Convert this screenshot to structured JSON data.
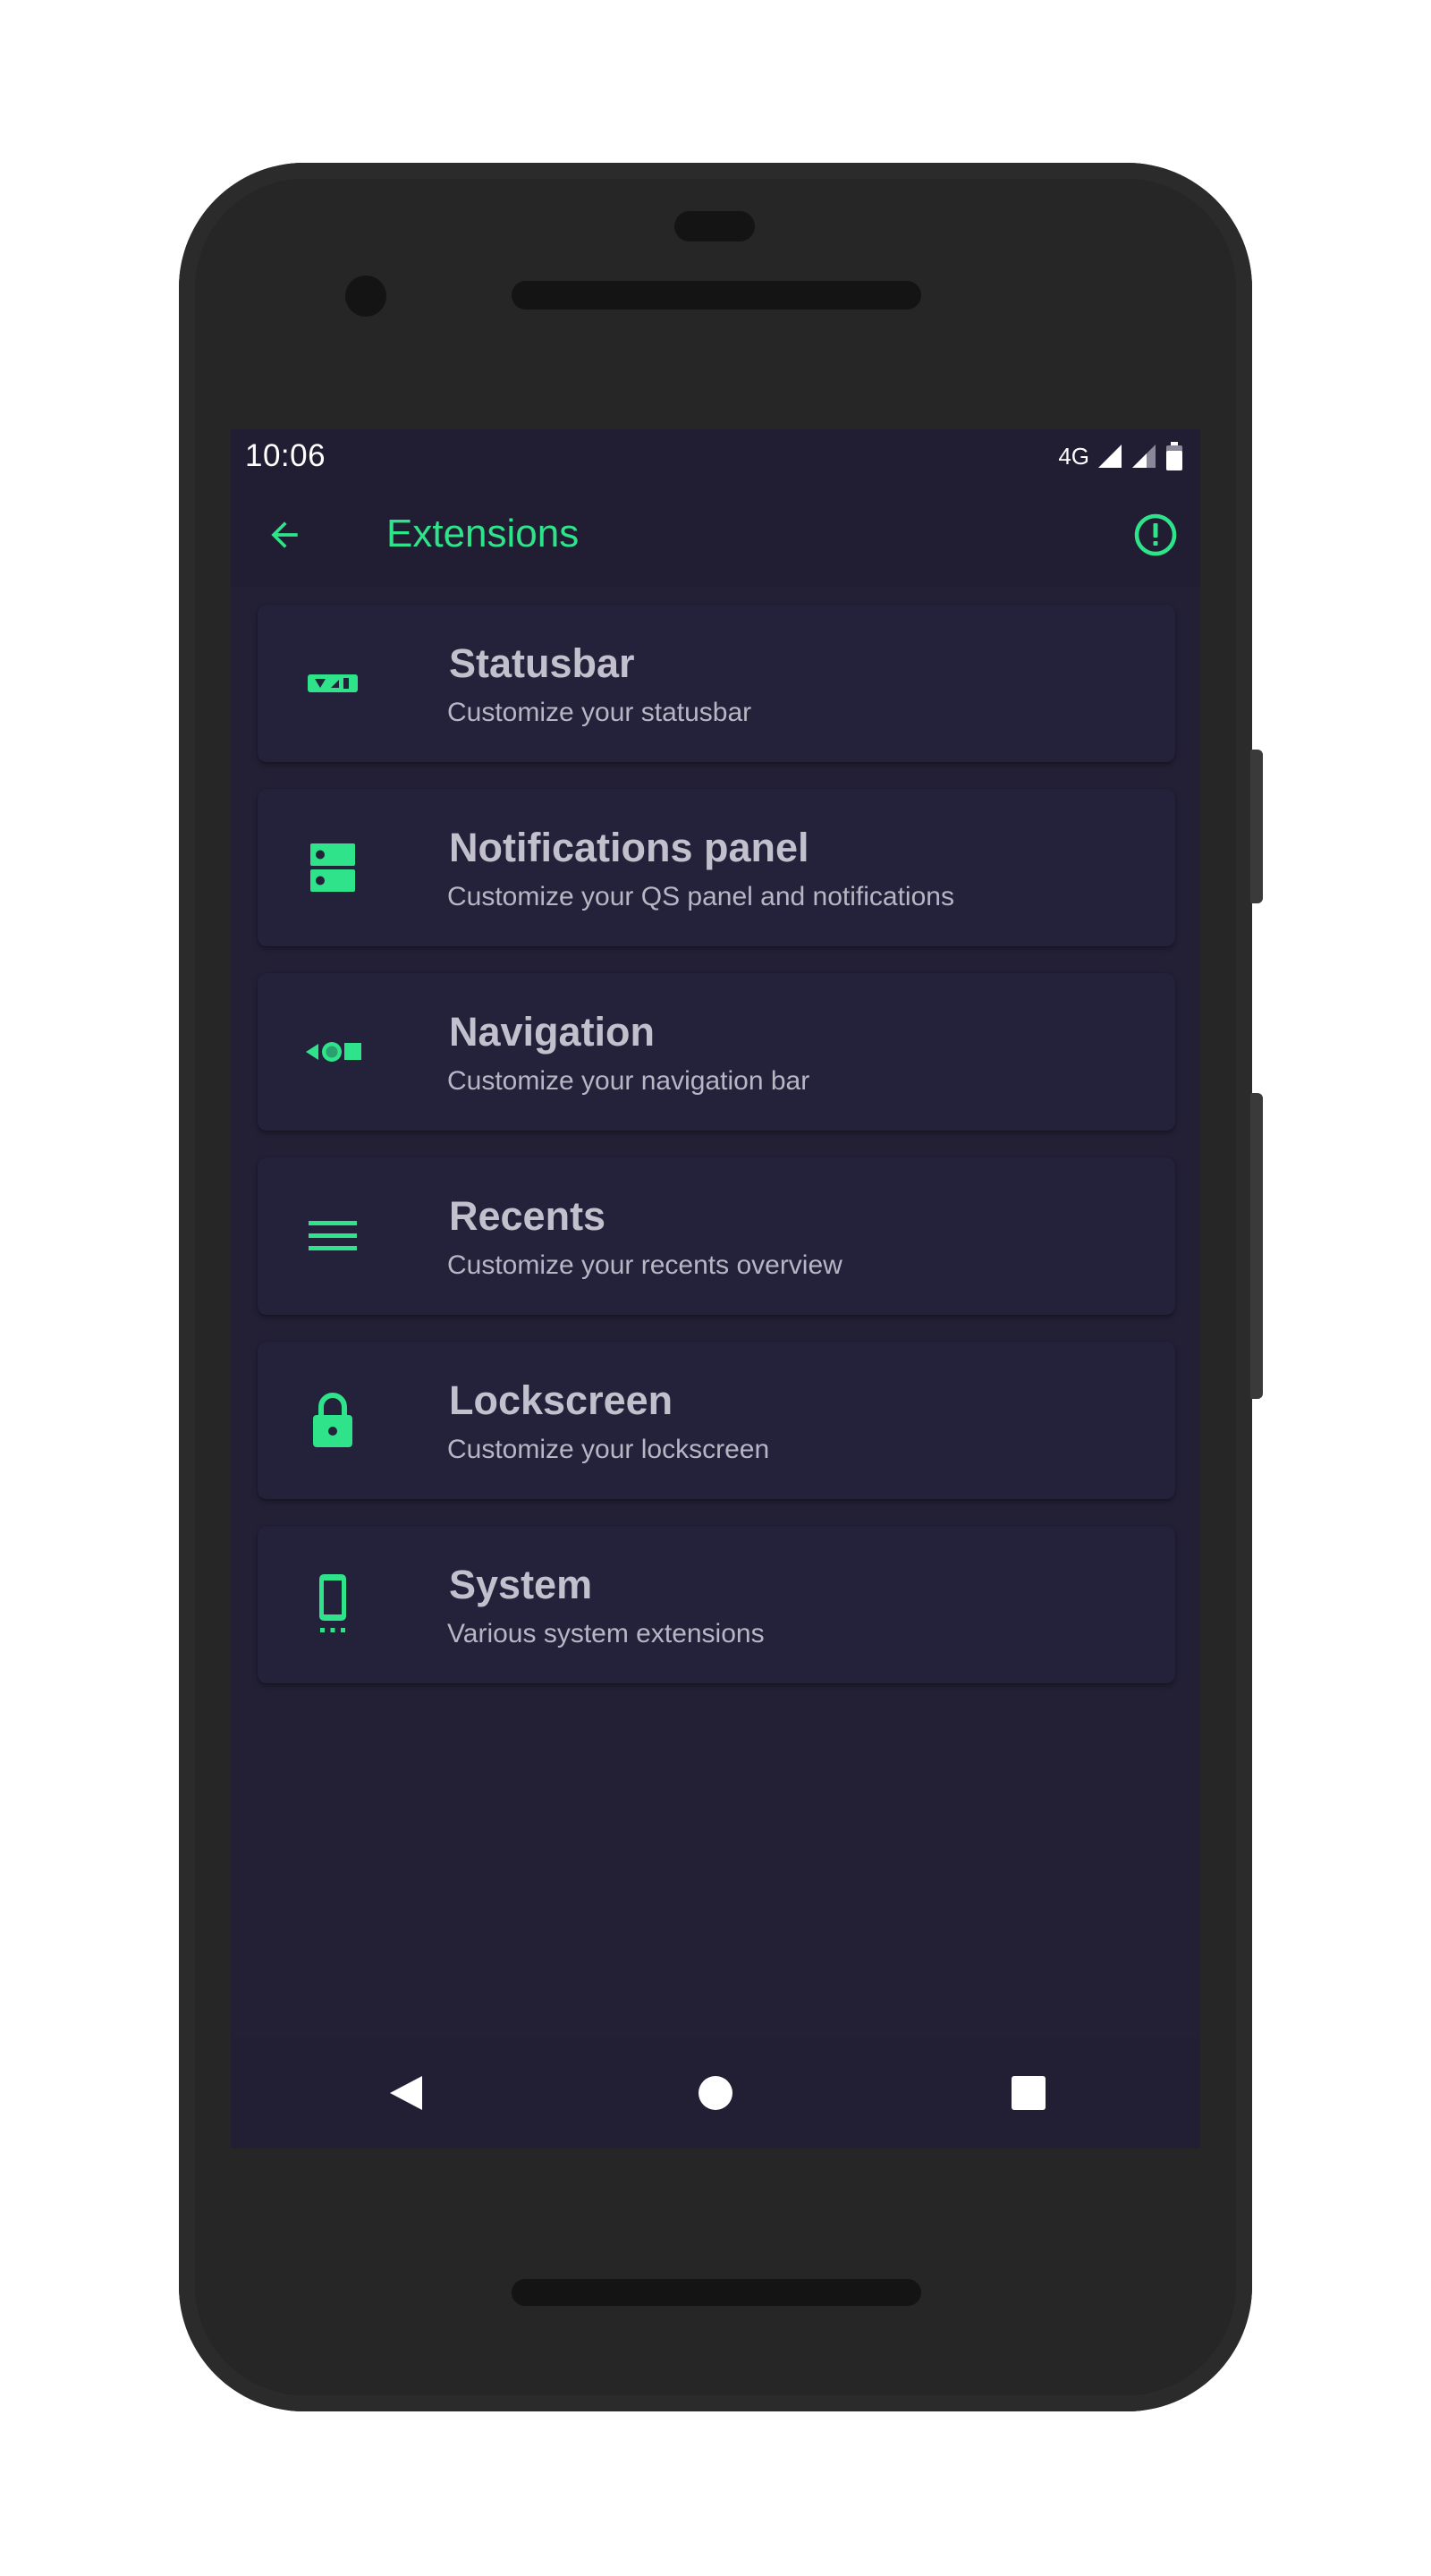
{
  "status_bar": {
    "time": "10:06",
    "network_type": "4G",
    "icons": [
      "signal-icon",
      "signal-icon",
      "battery-icon"
    ]
  },
  "app_bar": {
    "title": "Extensions",
    "back_icon": "arrow-back-icon",
    "action_icon": "info-circle-icon"
  },
  "extensions": [
    {
      "title": "Statusbar",
      "subtitle": "Customize your statusbar",
      "icon": "statusbar-icon"
    },
    {
      "title": "Notifications panel",
      "subtitle": "Customize your QS panel and notifications",
      "icon": "notifications-panel-icon"
    },
    {
      "title": "Navigation",
      "subtitle": "Customize your navigation bar",
      "icon": "navigation-icon"
    },
    {
      "title": "Recents",
      "subtitle": "Customize your recents overview",
      "icon": "recents-icon"
    },
    {
      "title": "Lockscreen",
      "subtitle": "Customize your lockscreen",
      "icon": "lock-icon"
    },
    {
      "title": "System",
      "subtitle": "Various system extensions",
      "icon": "phone-icon"
    }
  ],
  "nav_bar": {
    "icons": [
      "nav-back-icon",
      "nav-home-icon",
      "nav-recents-icon"
    ]
  },
  "colors": {
    "accent": "#2ee38a",
    "background": "#232036",
    "card": "#24213a",
    "title_text": "#c2c0cc",
    "subtitle_text": "#b8b6c4",
    "device": "#262626"
  }
}
